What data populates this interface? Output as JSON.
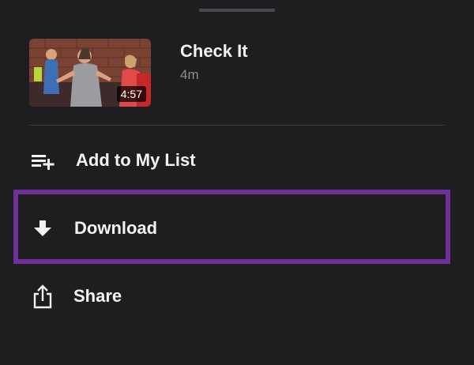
{
  "video": {
    "title": "Check It",
    "length": "4m",
    "duration_badge": "4:57",
    "thumbnail_description": "people dancing in a studio"
  },
  "actions": [
    {
      "label": "Add to My List",
      "icon": "add-to-list-icon"
    },
    {
      "label": "Download",
      "icon": "download-arrow-icon"
    },
    {
      "label": "Share",
      "icon": "share-icon"
    }
  ],
  "highlight": {
    "target": "Download",
    "color": "#6e2f9b"
  },
  "colors": {
    "background": "#1e1e20",
    "text_primary": "#f2f2f2",
    "text_secondary": "#8e8e93",
    "divider": "#3a3a3e"
  }
}
